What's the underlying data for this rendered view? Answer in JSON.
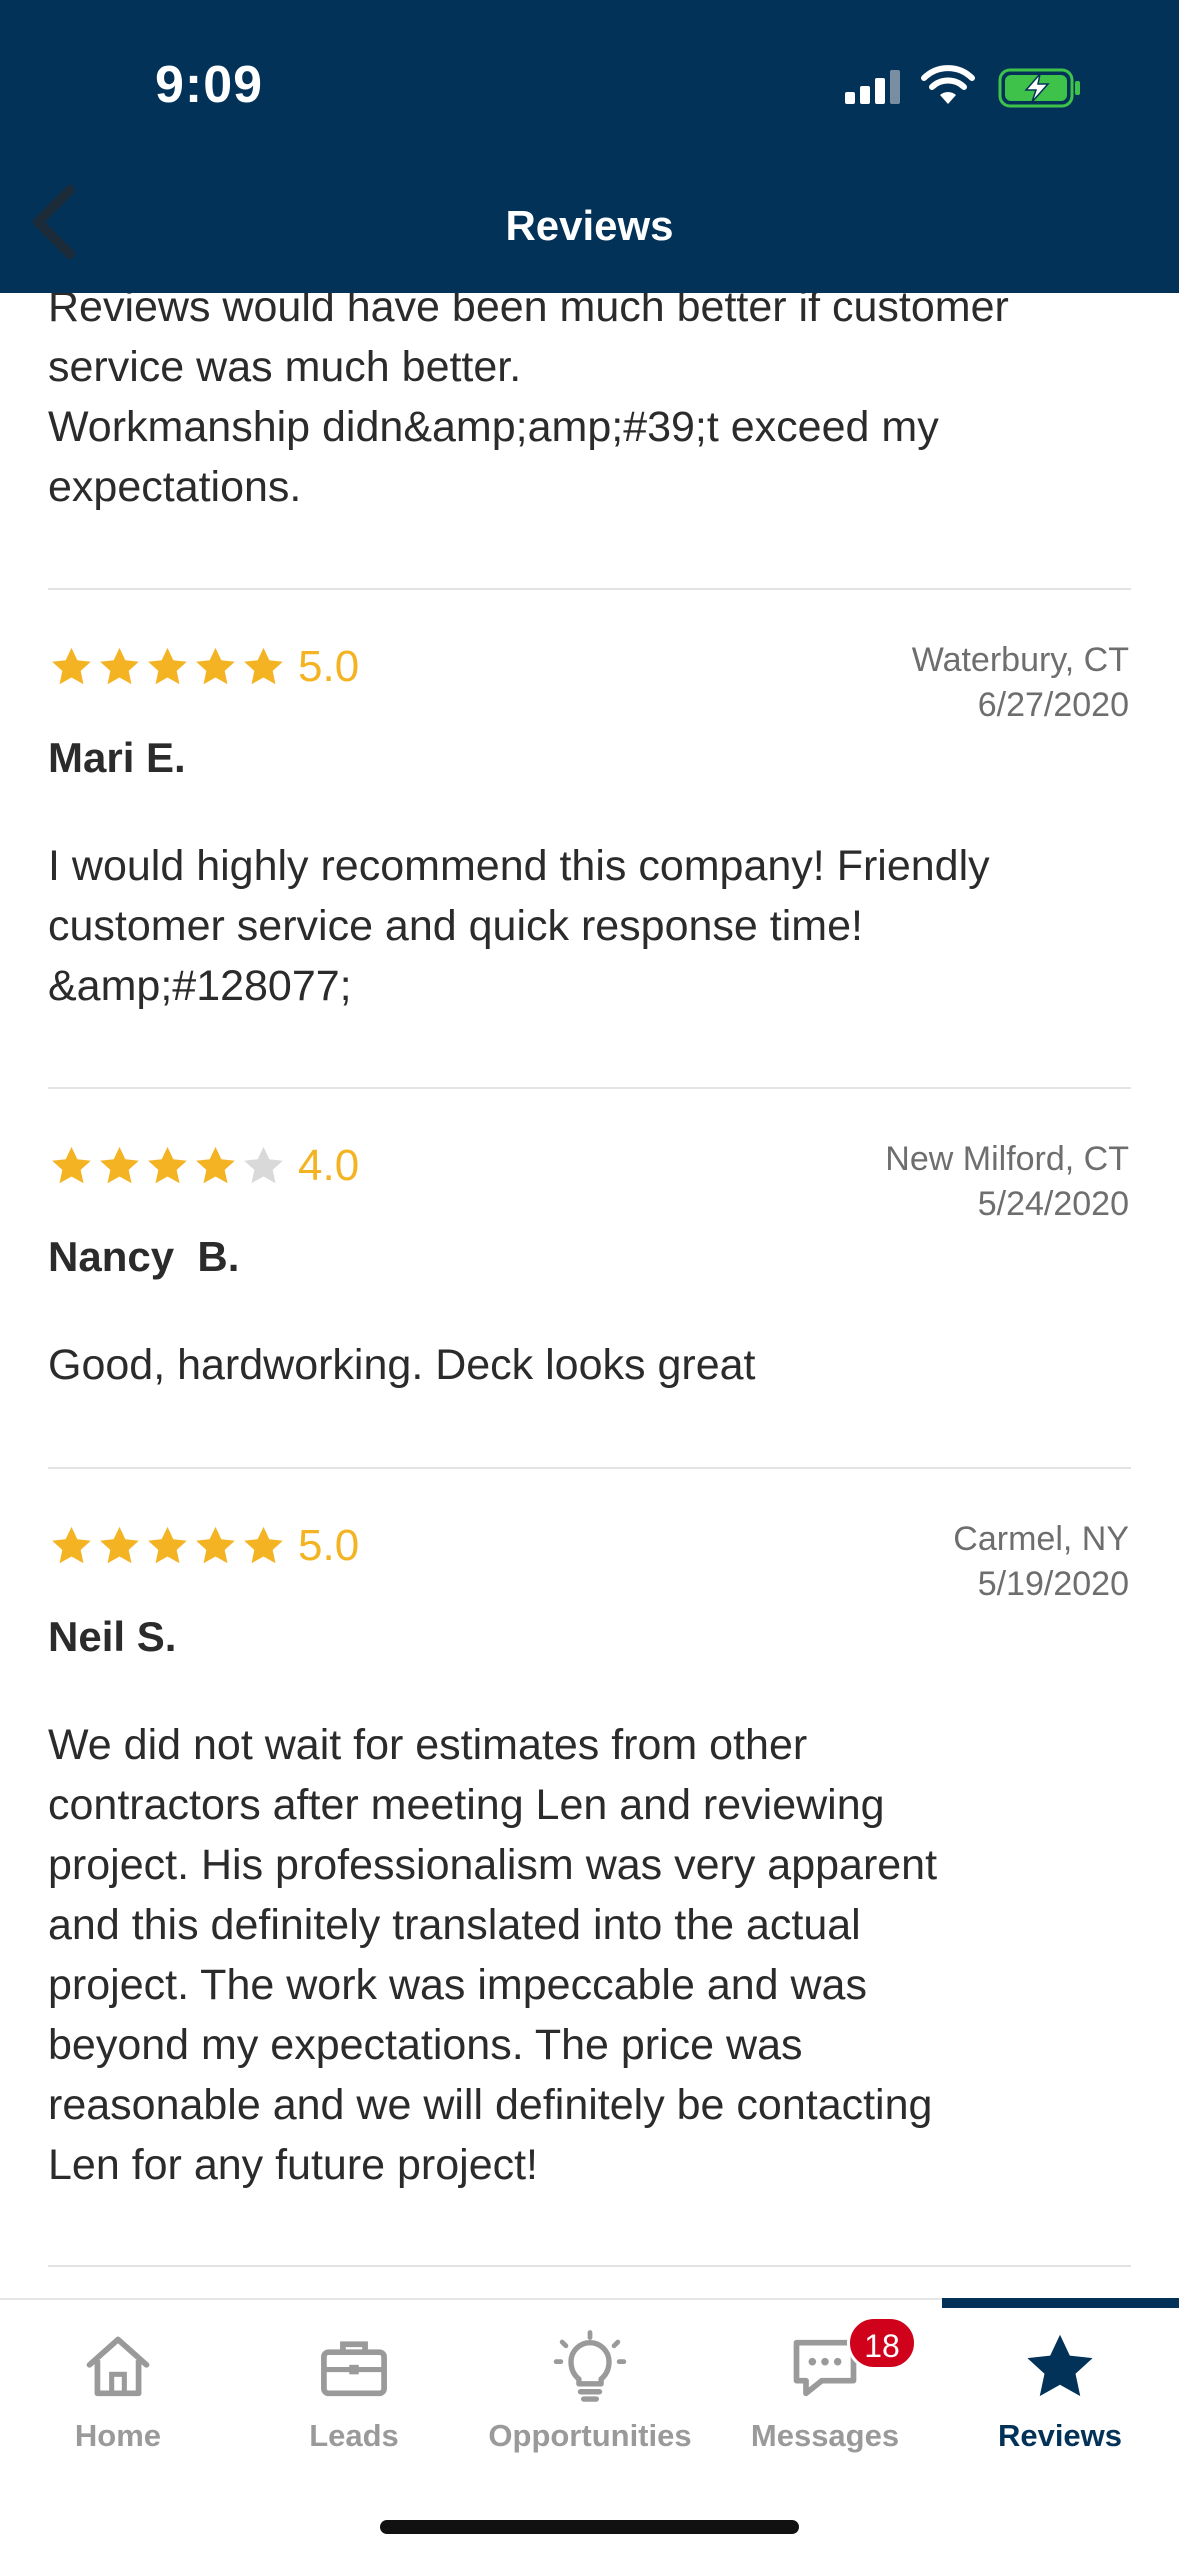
{
  "status_bar": {
    "time": "9:09"
  },
  "header": {
    "title": "Reviews"
  },
  "partial_review": {
    "text": "Reviews would have been much better if customer\nservice was much better.\nWorkmanship didn&amp;amp;#39;t exceed my\nexpectations."
  },
  "reviews": [
    {
      "rating": 5,
      "rating_label": "5.0",
      "location": "Waterbury, CT",
      "date": "6/27/2020",
      "name": "Mari E.",
      "text": "I would highly recommend this company! Friendly\ncustomer service and quick response time!\n&amp;#128077;"
    },
    {
      "rating": 4,
      "rating_label": "4.0",
      "location": "New Milford, CT",
      "date": "5/24/2020",
      "name": "Nancy  B.",
      "text": "Good, hardworking.  Deck looks great"
    },
    {
      "rating": 5,
      "rating_label": "5.0",
      "location": "Carmel, NY",
      "date": "5/19/2020",
      "name": "Neil S.",
      "text": "We did not wait for estimates from other\ncontractors after meeting Len and reviewing\nproject.  His professionalism was very apparent\nand this definitely translated into the actual\nproject.  The work was impeccable and was\nbeyond my expectations.  The price was\nreasonable and we will definitely be contacting\nLen for any future project!"
    }
  ],
  "tabbar": {
    "tabs": [
      {
        "label": "Home",
        "icon": "home-icon"
      },
      {
        "label": "Leads",
        "icon": "briefcase-icon"
      },
      {
        "label": "Opportunities",
        "icon": "lightbulb-icon"
      },
      {
        "label": "Messages",
        "icon": "chat-icon",
        "badge": "18"
      },
      {
        "label": "Reviews",
        "icon": "star-icon",
        "active": true
      }
    ]
  },
  "colors": {
    "header_bg": "#033259",
    "star_filled": "#f4b323",
    "star_empty": "#d9d9d9",
    "badge": "#d0021b",
    "active_tab": "#033259"
  }
}
